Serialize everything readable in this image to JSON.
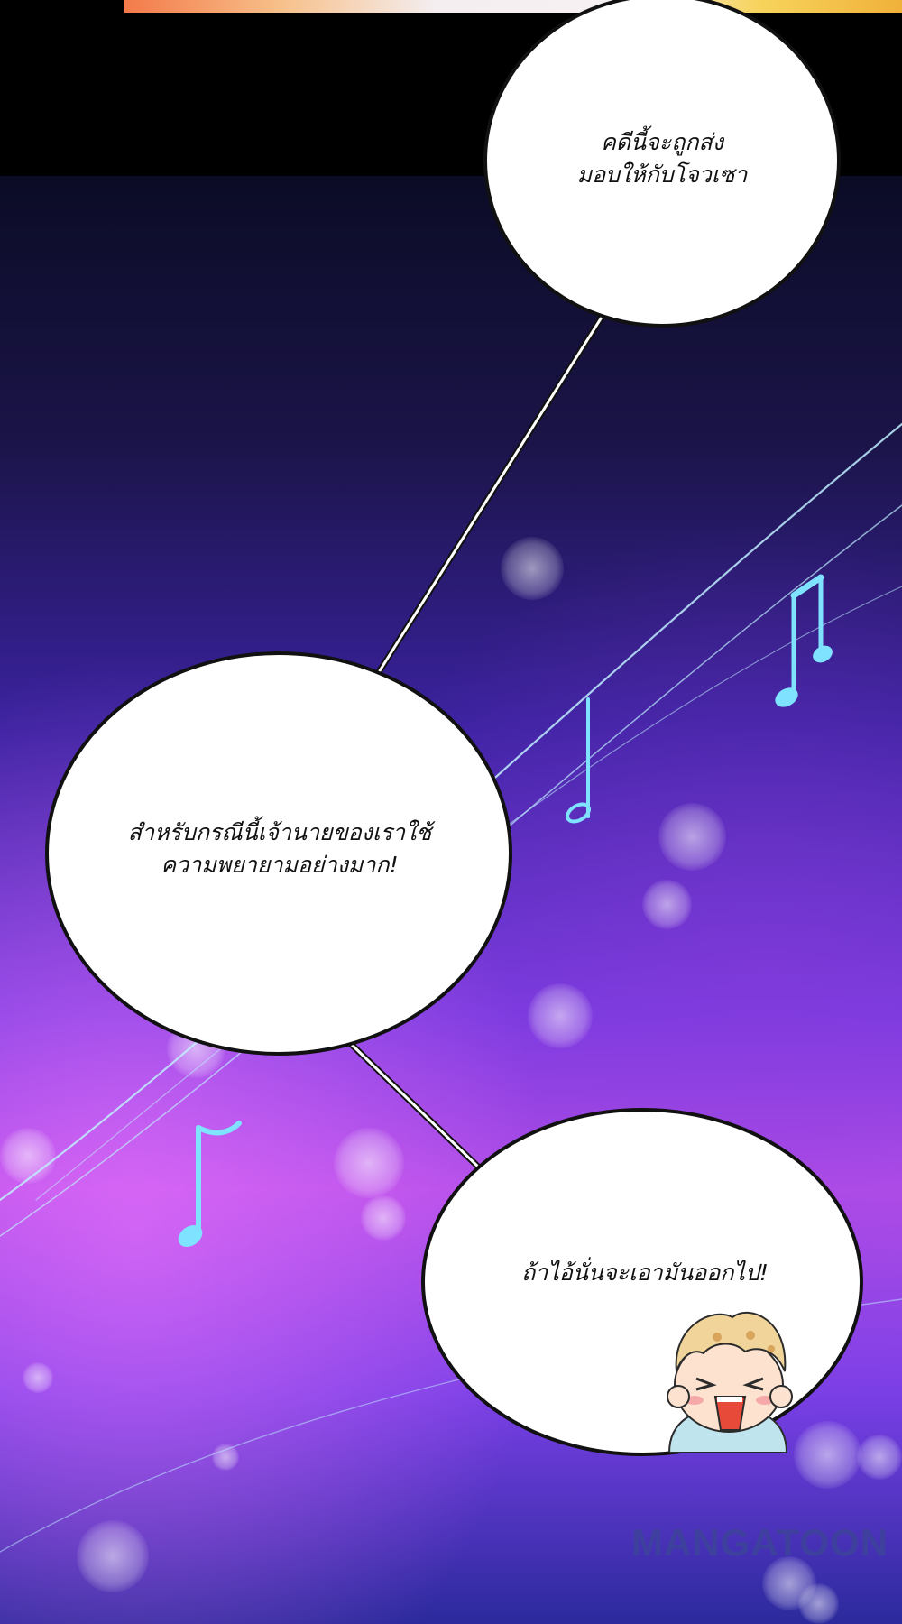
{
  "panel": {
    "bubbles": [
      {
        "lines": [
          "คดีนี้จะถูกส่ง",
          "มอบให้กับโจวเซา"
        ]
      },
      {
        "lines": [
          "สำหรับกรณีนี้เจ้านายของเราใช้",
          "ความพยายามอย่างมาก!"
        ]
      },
      {
        "lines": [
          "ถ้าไอ้นั่นจะเอามันออกไป!"
        ]
      }
    ],
    "watermark": "MANGATOON"
  },
  "colors": {
    "bubble_fill": "#ffffff",
    "bubble_stroke": "#111111",
    "music_accent": "#7fe3ff",
    "background_top": "#0b0c26",
    "background_mid": "#7a3be0"
  },
  "icons": {
    "music_notes": [
      "eighth-note-icon",
      "beamed-notes-icon",
      "eighth-note-icon"
    ]
  }
}
